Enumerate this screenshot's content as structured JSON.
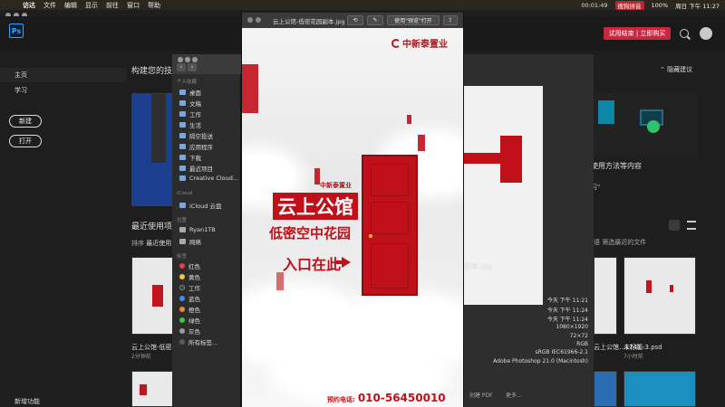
{
  "menubar": {
    "items": [
      "访达",
      "文件",
      "编辑",
      "显示",
      "前往",
      "窗口",
      "帮助"
    ],
    "recording_time": "00:01:49",
    "app_badge": "搜狗拼音",
    "battery": "100%",
    "datetime": "周日 下午 11:27"
  },
  "ps": {
    "logo": "Ps",
    "trial_label": "试用结束 | 立即购买",
    "nav": {
      "home": "主页",
      "learn": "学习",
      "new_button": "新建",
      "open_button": "打开",
      "new_features": "新增功能"
    },
    "main": {
      "title": "构建您的技",
      "hide_suggestions": "隐藏建议",
      "right_card_title": "使用方法等内容",
      "right_card_sub": "习\"",
      "recent_title": "最近使用项",
      "sort_label": "排序",
      "sort_value": "最近使用",
      "filter_text": "语 筛选最近的文件",
      "thumbs": [
        {
          "label": "云上公馆-低密...",
          "sub": "2分钟前"
        },
        {
          "label": "云上公馆...1741...",
          "sub": ""
        },
        {
          "label": "未标题-3.psd",
          "sub": "7小时前"
        }
      ]
    }
  },
  "finder": {
    "favorites_header": "个人收藏",
    "favorites": [
      "桌面",
      "文稿",
      "工作",
      "生活",
      "隔空投送",
      "应用程序",
      "下载",
      "最近项目",
      "Creative Cloud..."
    ],
    "icloud_header": "iCloud",
    "icloud": [
      "iCloud 云盘"
    ],
    "locations_header": "位置",
    "locations": [
      "Ryan1TB",
      "网络"
    ],
    "tags_header": "标签",
    "tags": [
      {
        "name": "红色",
        "color": "#e0443e"
      },
      {
        "name": "黄色",
        "color": "#f5c33b"
      },
      {
        "name": "工作",
        "color": "#3a3a3a"
      },
      {
        "name": "蓝色",
        "color": "#3d8ef0"
      },
      {
        "name": "橙色",
        "color": "#f08a24"
      },
      {
        "name": "绿色",
        "color": "#37c94b"
      },
      {
        "name": "灰色",
        "color": "#9a9a9a"
      },
      {
        "name": "所有标签...",
        "color": "#5a5a5a"
      }
    ]
  },
  "info": {
    "filename": "副本.jpg",
    "rows": [
      "今天 下午 11:21",
      "今天 下午 11:24",
      "今天 下午 11:24",
      "1080×1920",
      "72×72",
      "RGB",
      "sRGB IEC61966-2.1",
      "Adobe Photoshop 21.0 (Macintosh)"
    ],
    "create_pdf": "创建 PDF",
    "more": "更多..."
  },
  "preview": {
    "title": "云上公馆-低密花园副本.jpg",
    "open_with": "使用\"预览\"打开",
    "poster": {
      "brand": "中新泰置业",
      "small_brand": "中新泰置业",
      "headline": "云上公馆",
      "subheadline": "低密空中花园",
      "cta": "入口在此",
      "phone_label": "预约电话:",
      "phone_number": "010-56450010"
    }
  }
}
